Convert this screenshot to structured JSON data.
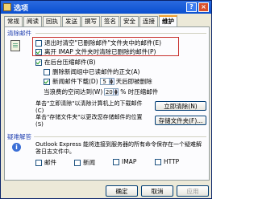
{
  "window": {
    "title": "选项",
    "help": "?",
    "close": "×"
  },
  "tabs": [
    "常规",
    "阅读",
    "回执",
    "发送",
    "撰写",
    "签名",
    "安全",
    "连接",
    "维护"
  ],
  "maintenance": {
    "section_label": "清除邮件",
    "opt_empty_deleted": "退出时清空\"已删除邮件\"文件夹中的邮件(E)",
    "opt_purge_imap": "离开 IMAP 文件夹时清除已删除的邮件(P)",
    "opt_background_compact": "在后台压缩邮件(B)",
    "opt_delete_read_bodies": "删除新闻组中已读邮件的正文(A)",
    "opt_delete_news_prefix": "新闻邮件下载(D)",
    "opt_delete_news_days": "5",
    "opt_delete_news_suffix": "天后即被删除",
    "opt_compact_prefix": "当浪费的空间达到(W)",
    "opt_compact_percent": "20",
    "opt_compact_suffix": "% 时压缩邮件",
    "clean_text": "单击\"立即清除\"以清除计算机上的下载邮件(C)",
    "clean_button": "立即清除(N)",
    "store_text": "单击\"存储文件夹\"以更改您存储邮件的位置(S)",
    "store_button": "存储文件夹(F)...",
    "trouble_label": "疑难解答",
    "trouble_text": "Outlook Express 能将连接到服务器的所有命令保存在一个疑难解答日志文件中。",
    "log_mail": "邮件",
    "log_news": "新闻",
    "log_imap": "IMAP",
    "log_http": "HTTP"
  },
  "buttons": {
    "ok": "确定",
    "cancel": "取消",
    "apply": "应用"
  },
  "colors": {
    "highlight": "#c8302c",
    "title_bar": "#0a4fd0"
  }
}
